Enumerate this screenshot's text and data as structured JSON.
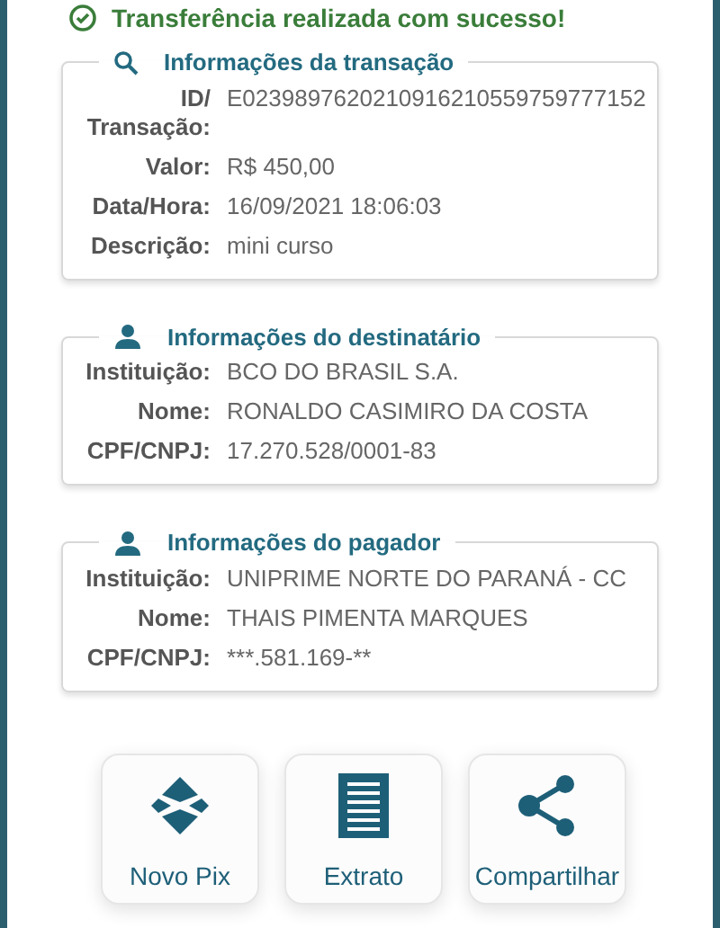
{
  "status_message": "Transferência realizada com sucesso!",
  "sections": [
    {
      "title": "Informações da transação",
      "fields": [
        {
          "label": "ID/ Transação:",
          "value": "E0239897620210916210559759777152"
        },
        {
          "label": "Valor:",
          "value": "R$ 450,00"
        },
        {
          "label": "Data/Hora:",
          "value": "16/09/2021 18:06:03"
        },
        {
          "label": "Descrição:",
          "value": "mini curso"
        }
      ]
    },
    {
      "title": "Informações do destinatário",
      "fields": [
        {
          "label": "Instituição:",
          "value": "BCO DO BRASIL S.A."
        },
        {
          "label": "Nome:",
          "value": "RONALDO CASIMIRO DA COSTA"
        },
        {
          "label": "CPF/CNPJ:",
          "value": "17.270.528/0001-83"
        }
      ]
    },
    {
      "title": "Informações do pagador",
      "fields": [
        {
          "label": "Instituição:",
          "value": "UNIPRIME NORTE DO PARANÁ - CC"
        },
        {
          "label": "Nome:",
          "value": "THAIS PIMENTA MARQUES"
        },
        {
          "label": "CPF/CNPJ:",
          "value": "***.581.169-**"
        }
      ]
    }
  ],
  "actions": [
    {
      "label": "Novo Pix"
    },
    {
      "label": "Extrato"
    },
    {
      "label": "Compartilhar"
    }
  ]
}
